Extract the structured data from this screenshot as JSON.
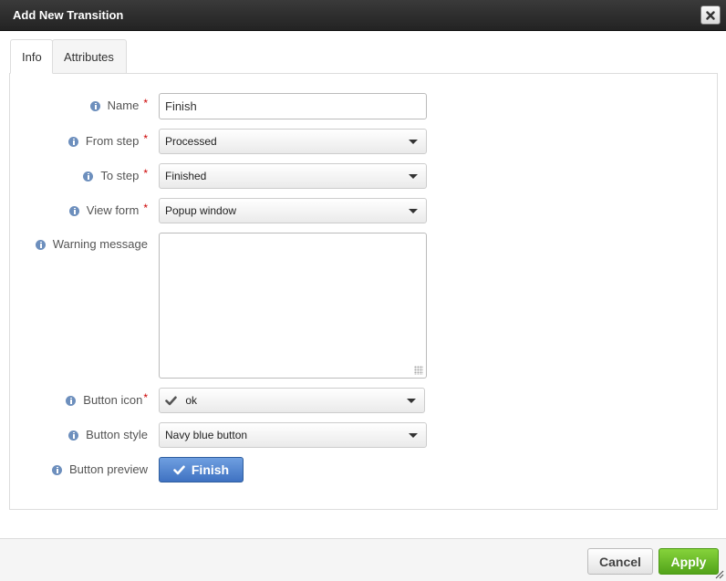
{
  "dialog": {
    "title": "Add New Transition",
    "close_icon": "close-icon"
  },
  "tabs": [
    {
      "label": "Info",
      "active": true
    },
    {
      "label": "Attributes",
      "active": false
    }
  ],
  "form": {
    "name": {
      "label": "Name",
      "required": "*",
      "value": "Finish"
    },
    "from_step": {
      "label": "From step",
      "required": "*",
      "value": "Processed"
    },
    "to_step": {
      "label": "To step",
      "required": "*",
      "value": "Finished"
    },
    "view_form": {
      "label": "View form",
      "required": "*",
      "value": "Popup window"
    },
    "warning_message": {
      "label": "Warning message",
      "value": ""
    },
    "button_icon": {
      "label": "Button icon",
      "required": "*",
      "value": "ok",
      "icon": "check-icon"
    },
    "button_style": {
      "label": "Button style",
      "value": "Navy blue button"
    },
    "button_preview": {
      "label": "Button preview",
      "button_label": "Finish",
      "icon": "check-icon"
    }
  },
  "footer": {
    "cancel_label": "Cancel",
    "apply_label": "Apply"
  },
  "colors": {
    "titlebar": "#2b2b2b",
    "required": "#cc0000",
    "info_icon": "#6d8fbd",
    "preview_button": "#4f7fcc",
    "apply_button": "#66b82a"
  }
}
